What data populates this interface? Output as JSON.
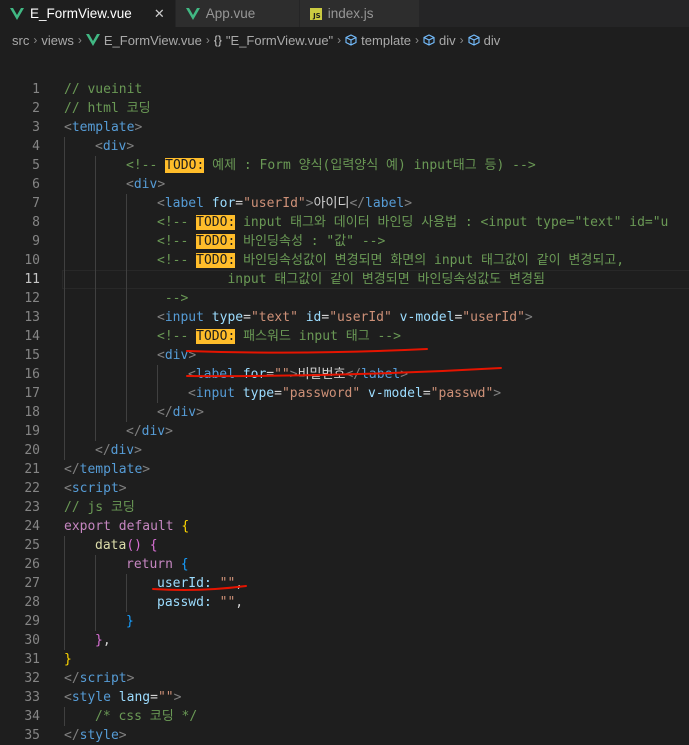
{
  "tabs": [
    {
      "label": "E_FormView.vue",
      "icon": "vue-icon",
      "active": true,
      "close": "✕"
    },
    {
      "label": "App.vue",
      "icon": "vue-icon",
      "active": false
    },
    {
      "label": "index.js",
      "icon": "js-icon",
      "icon_text": "JS",
      "active": false
    }
  ],
  "breadcrumb": {
    "src": "src",
    "views": "views",
    "file": "E_FormView.vue",
    "braces": "{}",
    "component": "\"E_FormView.vue\"",
    "template": "template",
    "div1": "div",
    "div2": "div"
  },
  "editor": {
    "current_line": 11,
    "lines": [
      {
        "n": "1",
        "indent": 0,
        "tokens": [
          [
            "t-com",
            "// vueinit"
          ]
        ]
      },
      {
        "n": "2",
        "indent": 0,
        "tokens": [
          [
            "t-com",
            "// html 코딩"
          ]
        ]
      },
      {
        "n": "3",
        "indent": 0,
        "tokens": [
          [
            "t-pun",
            "<"
          ],
          [
            "t-tag",
            "template"
          ],
          [
            "t-pun",
            ">"
          ]
        ]
      },
      {
        "n": "4",
        "indent": 1,
        "tokens": [
          [
            "t-pun",
            "<"
          ],
          [
            "t-tag",
            "div"
          ],
          [
            "t-pun",
            ">"
          ]
        ]
      },
      {
        "n": "5",
        "indent": 2,
        "tokens": [
          [
            "t-com",
            "<!-- "
          ],
          [
            "todo",
            "TODO:"
          ],
          [
            "t-com",
            " 예제 : Form 양식(입력양식 예) input태그 등) -->"
          ]
        ]
      },
      {
        "n": "6",
        "indent": 2,
        "tokens": [
          [
            "t-pun",
            "<"
          ],
          [
            "t-tag",
            "div"
          ],
          [
            "t-pun",
            ">"
          ]
        ]
      },
      {
        "n": "7",
        "indent": 3,
        "tokens": [
          [
            "t-pun",
            "<"
          ],
          [
            "t-tag",
            "label"
          ],
          [
            "t-txt",
            " "
          ],
          [
            "t-attr",
            "for"
          ],
          [
            "t-txt",
            "="
          ],
          [
            "t-str",
            "\"userId\""
          ],
          [
            "t-pun",
            ">"
          ],
          [
            "t-txt",
            "아이디"
          ],
          [
            "t-pun",
            "</"
          ],
          [
            "t-tag",
            "label"
          ],
          [
            "t-pun",
            ">"
          ]
        ]
      },
      {
        "n": "8",
        "indent": 3,
        "tokens": [
          [
            "t-com",
            "<!-- "
          ],
          [
            "todo",
            "TODO:"
          ],
          [
            "t-com",
            " input 태그와 데이터 바인딩 사용법 : <input type=\"text\" id=\"u"
          ]
        ]
      },
      {
        "n": "9",
        "indent": 3,
        "tokens": [
          [
            "t-com",
            "<!-- "
          ],
          [
            "todo",
            "TODO:"
          ],
          [
            "t-com",
            " 바인딩속성 : \"값\" -->"
          ]
        ]
      },
      {
        "n": "10",
        "indent": 3,
        "tokens": [
          [
            "t-com",
            "<!-- "
          ],
          [
            "todo",
            "TODO:"
          ],
          [
            "t-com",
            " 바인딩속성값이 변경되면 화면의 input 태그값이 같이 변경되고,"
          ]
        ]
      },
      {
        "n": "11",
        "indent": 3,
        "tokens": [
          [
            "t-com",
            "         input 태그값이 같이 변경되면 바인딩속성값도 변경됨"
          ]
        ]
      },
      {
        "n": "12",
        "indent": 3,
        "tokens": [
          [
            "t-com",
            " -->"
          ]
        ]
      },
      {
        "n": "13",
        "indent": 3,
        "tokens": [
          [
            "t-pun",
            "<"
          ],
          [
            "t-tag",
            "input"
          ],
          [
            "t-txt",
            " "
          ],
          [
            "t-attr",
            "type"
          ],
          [
            "t-txt",
            "="
          ],
          [
            "t-str",
            "\"text\""
          ],
          [
            "t-txt",
            " "
          ],
          [
            "t-attr",
            "id"
          ],
          [
            "t-txt",
            "="
          ],
          [
            "t-str",
            "\"userId\""
          ],
          [
            "t-txt",
            " "
          ],
          [
            "t-attr",
            "v-model"
          ],
          [
            "t-txt",
            "="
          ],
          [
            "t-str",
            "\"userId\""
          ],
          [
            "t-pun",
            ">"
          ]
        ]
      },
      {
        "n": "14",
        "indent": 3,
        "tokens": [
          [
            "t-com",
            "<!-- "
          ],
          [
            "todo",
            "TODO:"
          ],
          [
            "t-com",
            " 패스워드 input 태그 -->"
          ]
        ]
      },
      {
        "n": "15",
        "indent": 3,
        "tokens": [
          [
            "t-pun",
            "<"
          ],
          [
            "t-tag",
            "div"
          ],
          [
            "t-pun",
            ">"
          ]
        ]
      },
      {
        "n": "16",
        "indent": 4,
        "tokens": [
          [
            "t-pun",
            "<"
          ],
          [
            "t-tag",
            "label"
          ],
          [
            "t-txt",
            " "
          ],
          [
            "t-attr",
            "for"
          ],
          [
            "t-txt",
            "="
          ],
          [
            "t-str",
            "\"\""
          ],
          [
            "t-pun",
            ">"
          ],
          [
            "t-txt",
            "비밀번호"
          ],
          [
            "t-pun",
            "</"
          ],
          [
            "t-tag",
            "label"
          ],
          [
            "t-pun",
            ">"
          ]
        ]
      },
      {
        "n": "17",
        "indent": 4,
        "tokens": [
          [
            "t-pun",
            "<"
          ],
          [
            "t-tag",
            "input"
          ],
          [
            "t-txt",
            " "
          ],
          [
            "t-attr",
            "type"
          ],
          [
            "t-txt",
            "="
          ],
          [
            "t-str",
            "\"password\""
          ],
          [
            "t-txt",
            " "
          ],
          [
            "t-attr",
            "v-model"
          ],
          [
            "t-txt",
            "="
          ],
          [
            "t-str",
            "\"passwd\""
          ],
          [
            "t-pun",
            ">"
          ]
        ]
      },
      {
        "n": "18",
        "indent": 3,
        "tokens": [
          [
            "t-pun",
            "</"
          ],
          [
            "t-tag",
            "div"
          ],
          [
            "t-pun",
            ">"
          ]
        ]
      },
      {
        "n": "19",
        "indent": 2,
        "tokens": [
          [
            "t-pun",
            "</"
          ],
          [
            "t-tag",
            "div"
          ],
          [
            "t-pun",
            ">"
          ]
        ]
      },
      {
        "n": "20",
        "indent": 1,
        "tokens": [
          [
            "t-pun",
            "</"
          ],
          [
            "t-tag",
            "div"
          ],
          [
            "t-pun",
            ">"
          ]
        ]
      },
      {
        "n": "21",
        "indent": 0,
        "tokens": [
          [
            "t-pun",
            "</"
          ],
          [
            "t-tag",
            "template"
          ],
          [
            "t-pun",
            ">"
          ]
        ]
      },
      {
        "n": "22",
        "indent": 0,
        "tokens": [
          [
            "t-pun",
            "<"
          ],
          [
            "t-tag",
            "script"
          ],
          [
            "t-pun",
            ">"
          ]
        ]
      },
      {
        "n": "23",
        "indent": 0,
        "tokens": [
          [
            "t-com",
            "// js 코딩"
          ]
        ]
      },
      {
        "n": "24",
        "indent": 0,
        "tokens": [
          [
            "t-kw",
            "export"
          ],
          [
            "t-txt",
            " "
          ],
          [
            "t-kw",
            "default"
          ],
          [
            "t-txt",
            " "
          ],
          [
            "t-b1",
            "{"
          ]
        ]
      },
      {
        "n": "25",
        "indent": 1,
        "tokens": [
          [
            "t-fn",
            "data"
          ],
          [
            "t-b2",
            "()"
          ],
          [
            "t-txt",
            " "
          ],
          [
            "t-b2",
            "{"
          ]
        ]
      },
      {
        "n": "26",
        "indent": 2,
        "tokens": [
          [
            "t-kw",
            "return"
          ],
          [
            "t-txt",
            " "
          ],
          [
            "t-b3",
            "{"
          ]
        ]
      },
      {
        "n": "27",
        "indent": 3,
        "tokens": [
          [
            "t-attr",
            "userId"
          ],
          [
            "t-attr",
            ":"
          ],
          [
            "t-txt",
            " "
          ],
          [
            "t-str",
            "\"\""
          ],
          [
            "t-txt",
            ","
          ]
        ]
      },
      {
        "n": "28",
        "indent": 3,
        "tokens": [
          [
            "t-attr",
            "passwd"
          ],
          [
            "t-attr",
            ":"
          ],
          [
            "t-txt",
            " "
          ],
          [
            "t-str",
            "\"\""
          ],
          [
            "t-txt",
            ","
          ]
        ]
      },
      {
        "n": "29",
        "indent": 2,
        "tokens": [
          [
            "t-b3",
            "}"
          ]
        ]
      },
      {
        "n": "30",
        "indent": 1,
        "tokens": [
          [
            "t-b2",
            "}"
          ],
          [
            "t-txt",
            ","
          ]
        ]
      },
      {
        "n": "31",
        "indent": 0,
        "tokens": [
          [
            "t-b1",
            "}"
          ]
        ]
      },
      {
        "n": "32",
        "indent": 0,
        "tokens": [
          [
            "t-pun",
            "</"
          ],
          [
            "t-tag",
            "script"
          ],
          [
            "t-pun",
            ">"
          ]
        ]
      },
      {
        "n": "33",
        "indent": 0,
        "tokens": [
          [
            "t-pun",
            "<"
          ],
          [
            "t-tag",
            "style"
          ],
          [
            "t-txt",
            " "
          ],
          [
            "t-attr",
            "lang"
          ],
          [
            "t-txt",
            "="
          ],
          [
            "t-str",
            "\"\""
          ],
          [
            "t-pun",
            ">"
          ]
        ]
      },
      {
        "n": "34",
        "indent": 1,
        "tokens": [
          [
            "t-com",
            "/* css 코딩 */"
          ]
        ]
      },
      {
        "n": "35",
        "indent": 0,
        "tokens": [
          [
            "t-pun",
            "</"
          ],
          [
            "t-tag",
            "style"
          ],
          [
            "t-pun",
            ">"
          ]
        ]
      }
    ]
  },
  "colors": {
    "annotation_red": "#e51400",
    "todo_bg": "#ffbd2a"
  }
}
